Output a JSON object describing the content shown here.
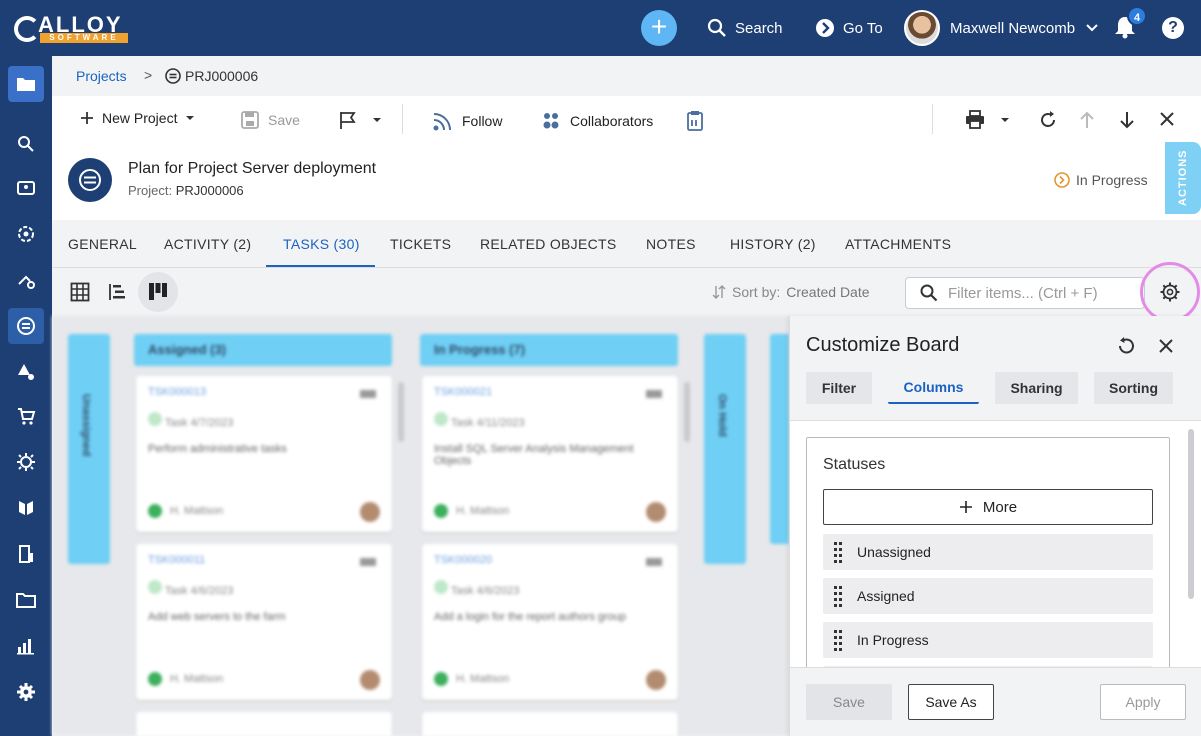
{
  "topbar": {
    "logo_text": "ALLOY",
    "logo_subtext": "SOFTWARE",
    "search_label": "Search",
    "goto_label": "Go To",
    "user_name": "Maxwell Newcomb",
    "notification_count": "4",
    "help_label": "?"
  },
  "breadcrumb": {
    "projects": "Projects",
    "separator": ">",
    "current": "PRJ000006"
  },
  "toolbar": {
    "new_project": "New Project",
    "save": "Save",
    "follow": "Follow",
    "collaborators": "Collaborators"
  },
  "header": {
    "title": "Plan for Project Server deployment",
    "sub_label": "Project:",
    "sub_value": "PRJ000006",
    "status": "In Progress",
    "actions": "ACTIONS"
  },
  "tabs": [
    {
      "label": "GENERAL"
    },
    {
      "label": "ACTIVITY (2)"
    },
    {
      "label": "TASKS (30)"
    },
    {
      "label": "TICKETS"
    },
    {
      "label": "RELATED OBJECTS"
    },
    {
      "label": "NOTES"
    },
    {
      "label": "HISTORY (2)"
    },
    {
      "label": "ATTACHMENTS"
    }
  ],
  "viewbar": {
    "sort_label": "Sort by:",
    "sort_value": "Created Date",
    "filter_placeholder": "Filter items... (Ctrl + F)"
  },
  "board": {
    "columns": [
      {
        "label": "Unassigned"
      },
      {
        "label": "Assigned (3)"
      },
      {
        "label": "In Progress (7)"
      },
      {
        "label": "On Hold"
      }
    ],
    "cards": [
      {
        "id": "TSK000013",
        "type": "Task",
        "date": "4/7/2023",
        "text": "Perform administrative tasks",
        "owner": "H. Mattson"
      },
      {
        "id": "TSK000011",
        "type": "Task",
        "date": "4/6/2023",
        "text": "Add web servers to the farm",
        "owner": "H. Mattson"
      },
      {
        "id": "TSK000021",
        "type": "Task",
        "date": "4/11/2023",
        "text": "Install SQL Server Analysis Management Objects",
        "owner": "H. Mattson"
      },
      {
        "id": "TSK000020",
        "type": "Task",
        "date": "4/6/2023",
        "text": "Add a login for the report authors group",
        "owner": "H. Mattson"
      }
    ]
  },
  "panel": {
    "title": "Customize Board",
    "tabs": [
      {
        "label": "Filter"
      },
      {
        "label": "Columns"
      },
      {
        "label": "Sharing"
      },
      {
        "label": "Sorting"
      }
    ],
    "statuses_title": "Statuses",
    "more_label": "More",
    "statuses": [
      {
        "label": "Unassigned"
      },
      {
        "label": "Assigned"
      },
      {
        "label": "In Progress"
      }
    ],
    "save": "Save",
    "save_as": "Save As",
    "apply": "Apply"
  },
  "colors": {
    "nav": "#1d3f74",
    "accent": "#1a63c2",
    "column_header": "#6fcff5",
    "highlight_ring": "#e48be8",
    "status_orange": "#f0a22e"
  }
}
